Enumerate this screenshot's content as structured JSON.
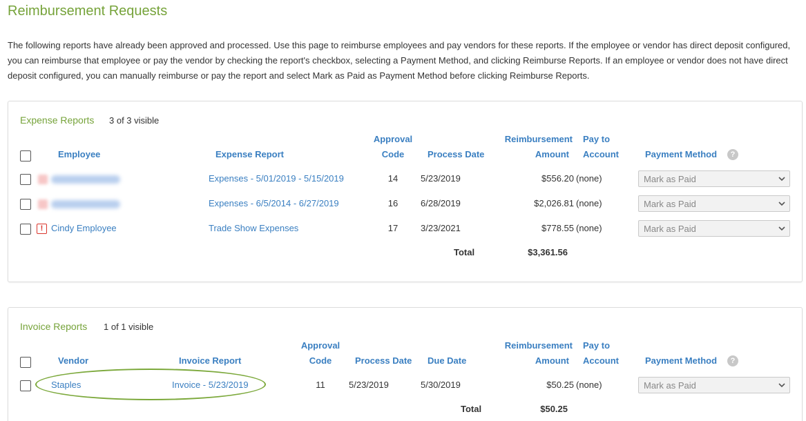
{
  "page": {
    "title": "Reimbursement Requests",
    "intro": "The following reports have already been approved and processed. Use this page to reimburse employees and pay vendors for these reports. If the employee or vendor has direct deposit configured, you can reimburse that employee or pay the vendor by checking the report's checkbox, selecting a Payment Method, and clicking Reimburse Reports. If an employee or vendor does not have direct deposit configured, you can manually reimburse or pay the report and select Mark as Paid as Payment Method before clicking Reimburse Reports."
  },
  "expense": {
    "title": "Expense Reports",
    "count": "3 of 3 visible",
    "headers": {
      "employee": "Employee",
      "report": "Expense Report",
      "approval_1": "Approval",
      "approval_2": "Code",
      "process_date": "Process Date",
      "reimb_1": "Reimbursement",
      "reimb_2": "Amount",
      "payto_1": "Pay to",
      "payto_2": "Account",
      "payment_method": "Payment Method"
    },
    "rows": [
      {
        "employee": "",
        "report": "Expenses - 5/01/2019 - 5/15/2019",
        "code": "14",
        "date": "5/23/2019",
        "amount": "$556.20",
        "account": "(none)",
        "method": "Mark as Paid"
      },
      {
        "employee": "",
        "report": "Expenses - 6/5/2014 - 6/27/2019",
        "code": "16",
        "date": "6/28/2019",
        "amount": "$2,026.81",
        "account": "(none)",
        "method": "Mark as Paid"
      },
      {
        "employee": "Cindy Employee",
        "report": "Trade Show Expenses",
        "code": "17",
        "date": "3/23/2021",
        "amount": "$778.55",
        "account": "(none)",
        "method": "Mark as Paid"
      }
    ],
    "total_label": "Total",
    "total_value": "$3,361.56"
  },
  "invoice": {
    "title": "Invoice Reports",
    "count": "1 of 1 visible",
    "headers": {
      "vendor": "Vendor",
      "report": "Invoice Report",
      "approval_1": "Approval",
      "approval_2": "Code",
      "process_date": "Process Date",
      "due_date": "Due Date",
      "reimb_1": "Reimbursement",
      "reimb_2": "Amount",
      "payto_1": "Pay to",
      "payto_2": "Account",
      "payment_method": "Payment Method"
    },
    "rows": [
      {
        "vendor": "Staples",
        "report": "Invoice - 5/23/2019",
        "code": "11",
        "date": "5/23/2019",
        "due": "5/30/2019",
        "amount": "$50.25",
        "account": "(none)",
        "method": "Mark as Paid"
      }
    ],
    "total_label": "Total",
    "total_value": "$50.25"
  },
  "icons": {
    "help": "?",
    "alert": "!"
  },
  "colors": {
    "accent_green": "#76a33a",
    "link_blue": "#3a7fc1",
    "alert_red": "#d9342b"
  }
}
